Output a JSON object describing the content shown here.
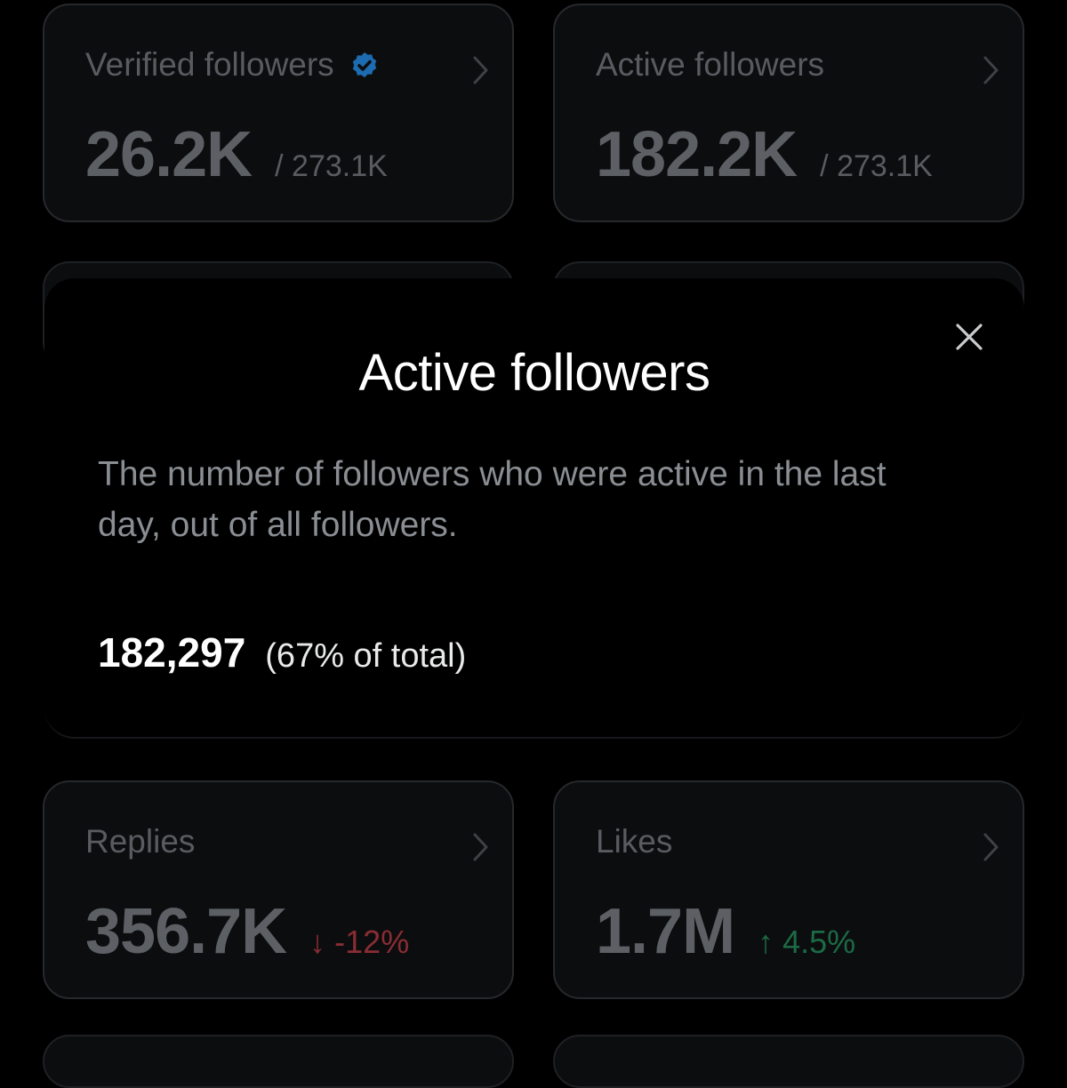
{
  "cards": {
    "verified_followers": {
      "title": "Verified followers",
      "value": "26.2K",
      "total": "/ 273.1K"
    },
    "active_followers": {
      "title": "Active followers",
      "value": "182.2K",
      "total": "/ 273.1K"
    },
    "replies": {
      "title": "Replies",
      "value": "356.7K",
      "delta": "↓ -12%"
    },
    "likes": {
      "title": "Likes",
      "value": "1.7M",
      "delta": "↑ 4.5%"
    }
  },
  "modal": {
    "title": "Active followers",
    "description": "The number of followers who were active in the last day, out of all followers.",
    "stat_value": "182,297",
    "stat_percent": "(67% of total)"
  },
  "colors": {
    "verified_badge": "#1d6bb0",
    "delta_down": "#8a2c33",
    "delta_up": "#1c6a45"
  },
  "icons": {
    "verified": "verified-badge-icon",
    "chevron": "chevron-right-icon",
    "close": "close-icon"
  }
}
